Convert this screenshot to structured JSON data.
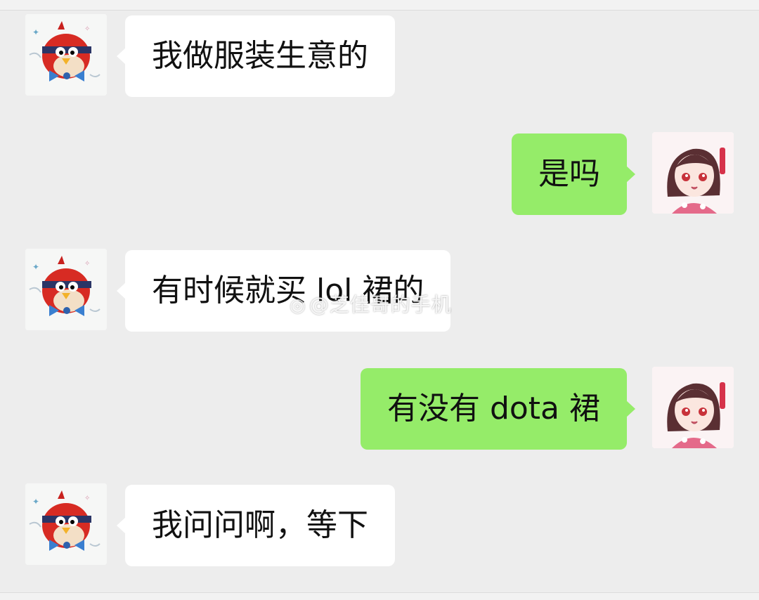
{
  "messages": [
    {
      "side": "incoming",
      "text": "我做服装生意的",
      "avatar": "red-bird-avatar"
    },
    {
      "side": "outgoing",
      "text": "是吗",
      "avatar": "anime-girl-avatar"
    },
    {
      "side": "incoming",
      "text": "有时候就买 lol 裙的",
      "avatar": "red-bird-avatar"
    },
    {
      "side": "outgoing",
      "text": "有没有 dota 裙",
      "avatar": "anime-girl-avatar"
    },
    {
      "side": "incoming",
      "text": "我问问啊，等下",
      "avatar": "red-bird-avatar"
    }
  ],
  "watermark": {
    "icon": "weibo-icon",
    "text": "@芝佳哥的手机"
  },
  "colors": {
    "background": "#ededed",
    "incoming_bubble": "#ffffff",
    "outgoing_bubble": "#95ec69",
    "text": "#111111"
  }
}
